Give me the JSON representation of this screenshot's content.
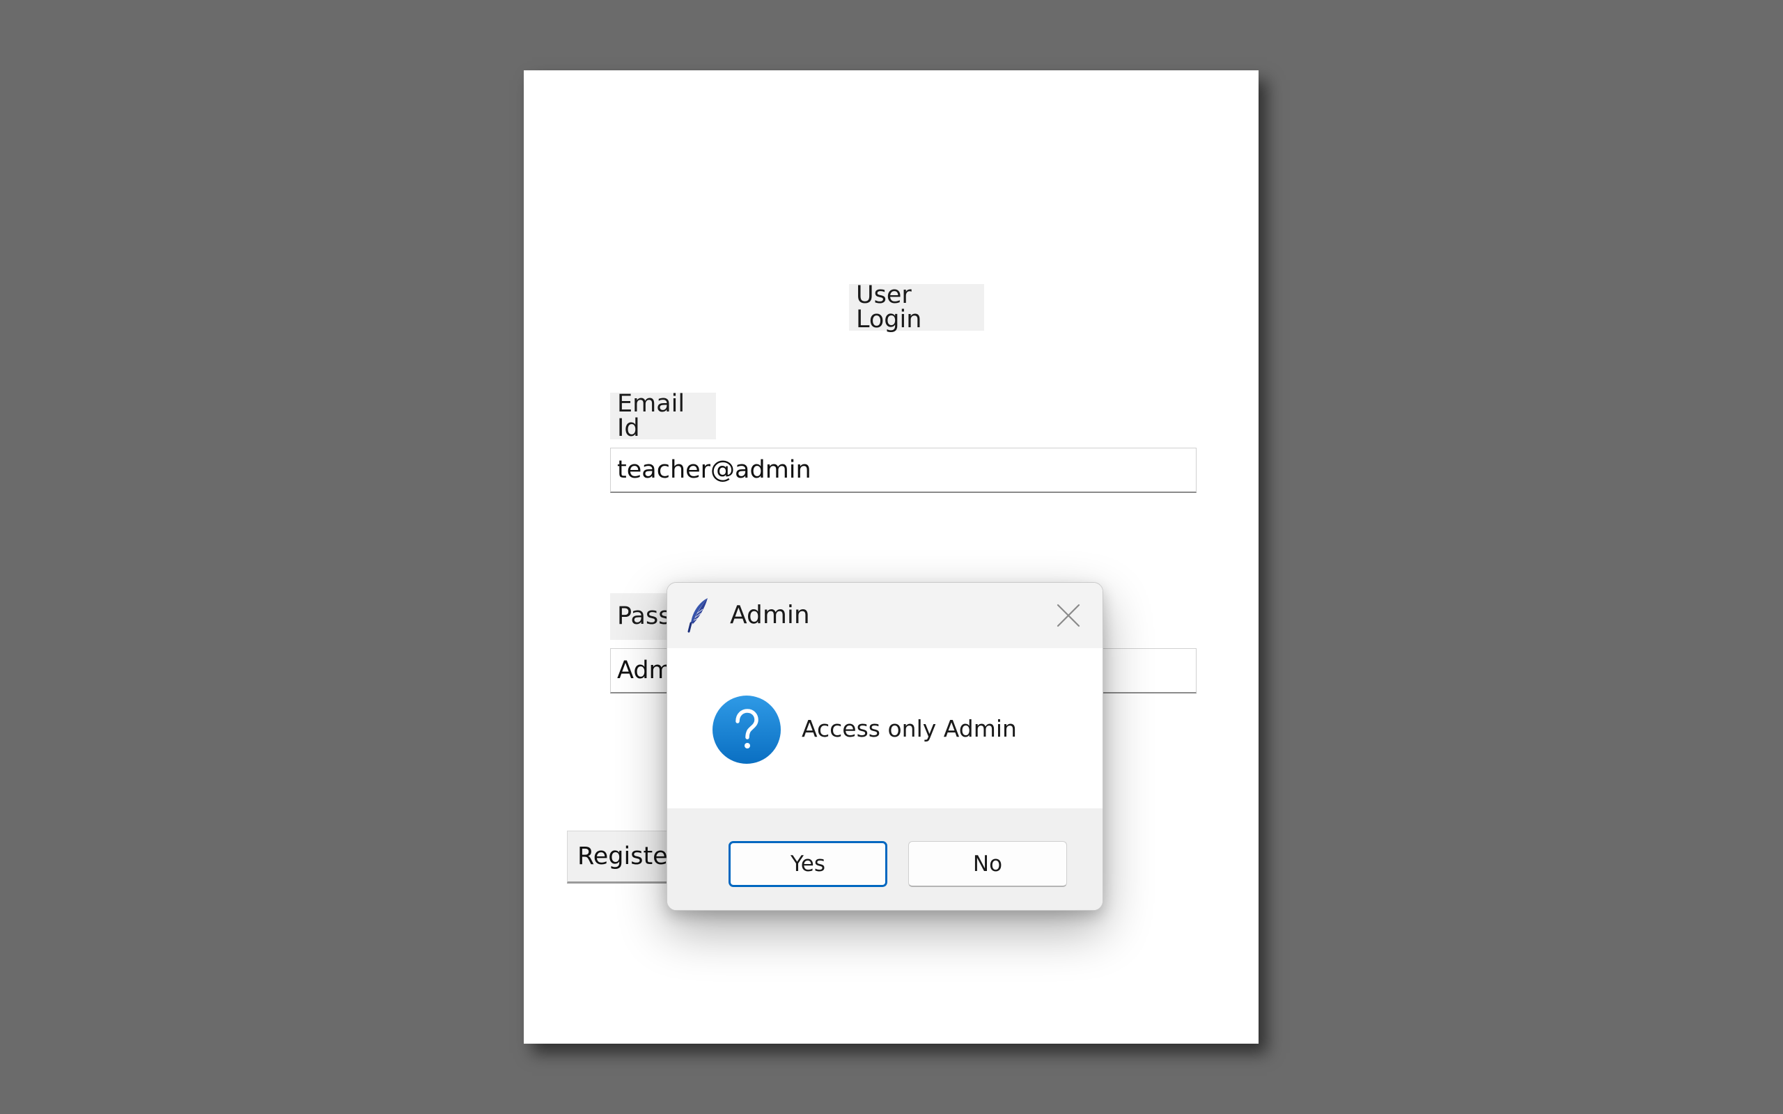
{
  "login_window": {
    "title": "User Login",
    "email_label": "Email Id",
    "email_value": "teacher@admin",
    "password_label": "Password",
    "password_value": "Adm",
    "register_label": "Register"
  },
  "dialog": {
    "title": "Admin",
    "message": "Access only Admin",
    "yes_label": "Yes",
    "no_label": "No",
    "icons": {
      "app": "feather-icon",
      "close": "close-icon",
      "message": "question-icon"
    },
    "accent_color": "#0067c0"
  }
}
